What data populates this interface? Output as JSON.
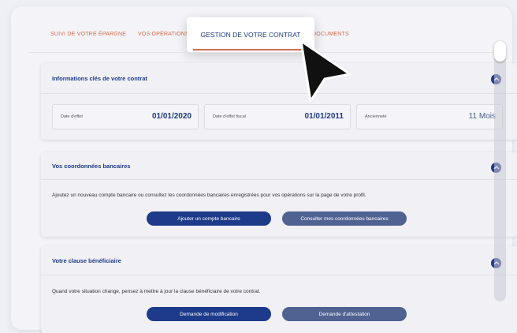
{
  "tabs": [
    {
      "label": "SUIVI DE VOTRE ÉPARGNE"
    },
    {
      "label": "VOS OPÉRATIONS"
    },
    {
      "label": "GESTION DE VOTRE CONTRAT",
      "active": true
    },
    {
      "label": "DOCUMENTS"
    }
  ],
  "colors": {
    "accent": "#d96b4e",
    "primary": "#1e3a8a"
  },
  "panels": {
    "contract": {
      "title": "Informations clés de votre contrat",
      "items": [
        {
          "label": "Date d'effet",
          "value": "01/01/2020"
        },
        {
          "label": "Date d'effet fiscal",
          "value": "01/01/2011"
        },
        {
          "label": "Ancienneté",
          "value": "11 Mois"
        }
      ]
    },
    "bank": {
      "title": "Vos coordonnées bancaires",
      "description": "Ajoutez un nouveau compte bancaire ou consultez les coordonnées bancaires enregistrées pour vos opérations sur la page de votre profil.",
      "buttons": [
        "Ajouter un compte bancaire",
        "Consulter mes coordonnées bancaires"
      ]
    },
    "beneficiary": {
      "title": "Votre clause bénéficiaire",
      "description": "Quand votre situation change, pensez à mettre à jour la clause bénéficiaire de votre contrat.",
      "buttons": [
        "Demande de modification",
        "Demande d'attestation"
      ]
    }
  },
  "icons": {
    "collapse": "chevron-up-icon",
    "pointer": "mouse-pointer-icon"
  }
}
